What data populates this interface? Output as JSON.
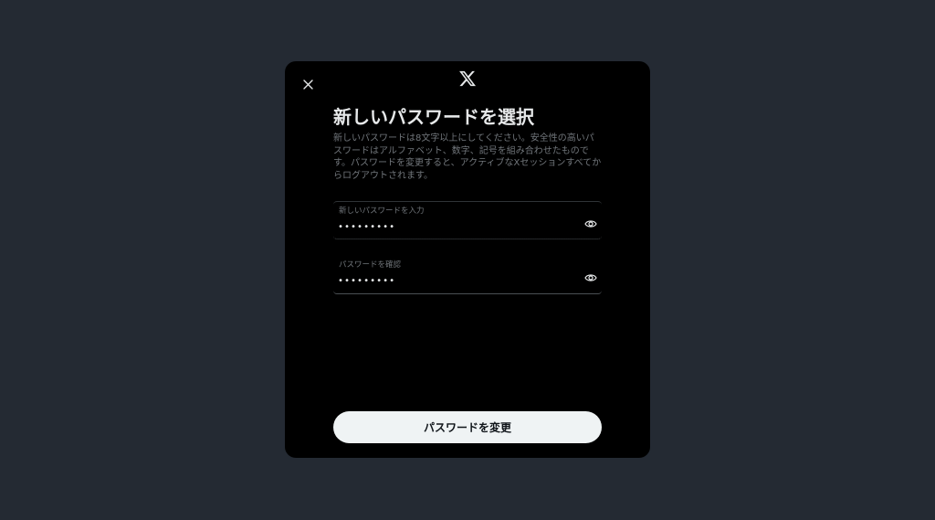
{
  "modal": {
    "close_icon": "close-icon",
    "logo_icon": "x-logo-icon",
    "title": "新しいパスワードを選択",
    "description": "新しいパスワードは8文字以上にしてください。安全性の高いパスワードはアルファベット、数字、記号を組み合わせたものです。パスワードを変更すると、アクティブなXセッションすべてからログアウトされます。",
    "fields": [
      {
        "label": "新しいパスワードを入力",
        "value": "•••••••••",
        "icon": "eye-icon"
      },
      {
        "label": "パスワードを確認",
        "value": "•••••••••",
        "icon": "eye-icon"
      }
    ],
    "submit_label": "パスワードを変更"
  },
  "colors": {
    "background": "#242a33",
    "modal": "#000000",
    "text_primary": "#e7e9ea",
    "text_secondary": "#71767b",
    "button_bg": "#eff3f4",
    "button_text": "#0f1419"
  }
}
